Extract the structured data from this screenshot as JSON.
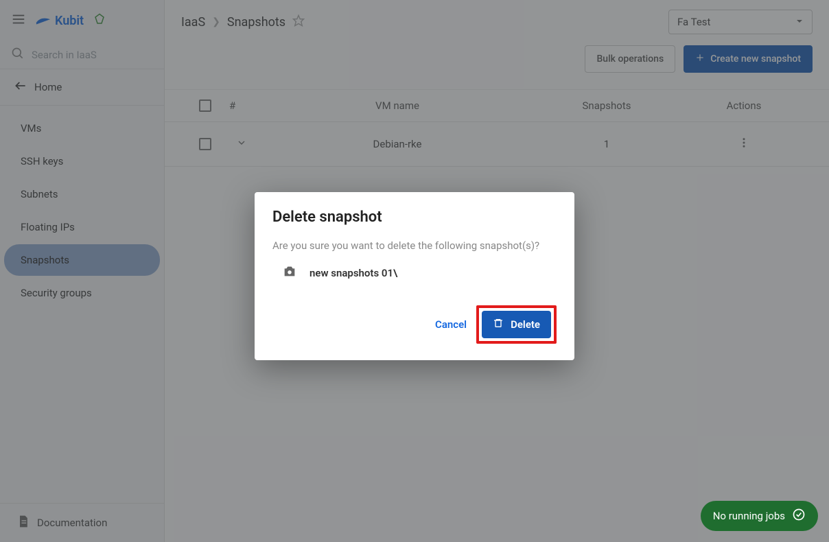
{
  "brand": {
    "name": "Kubit"
  },
  "search": {
    "placeholder": "Search in IaaS"
  },
  "home_label": "Home",
  "nav": {
    "items": [
      {
        "label": "VMs"
      },
      {
        "label": "SSH keys"
      },
      {
        "label": "Subnets"
      },
      {
        "label": "Floating IPs"
      },
      {
        "label": "Snapshots"
      },
      {
        "label": "Security groups"
      }
    ],
    "active_index": 4
  },
  "documentation_label": "Documentation",
  "breadcrumb": {
    "root": "IaaS",
    "page": "Snapshots"
  },
  "project_select": {
    "value": "Fa Test"
  },
  "actions": {
    "bulk_label": "Bulk operations",
    "create_label": "Create new snapshot"
  },
  "table": {
    "headers": {
      "index": "#",
      "vm": "VM name",
      "snapshots": "Snapshots",
      "actions": "Actions"
    },
    "rows": [
      {
        "vm": "Debian-rke",
        "snapshots": "1"
      }
    ]
  },
  "dialog": {
    "title": "Delete snapshot",
    "message": "Are you sure you want to delete the following snapshot(s)?",
    "snapshot_name": "new snapshots 01\\",
    "cancel_label": "Cancel",
    "delete_label": "Delete"
  },
  "jobs": {
    "label": "No running jobs"
  }
}
